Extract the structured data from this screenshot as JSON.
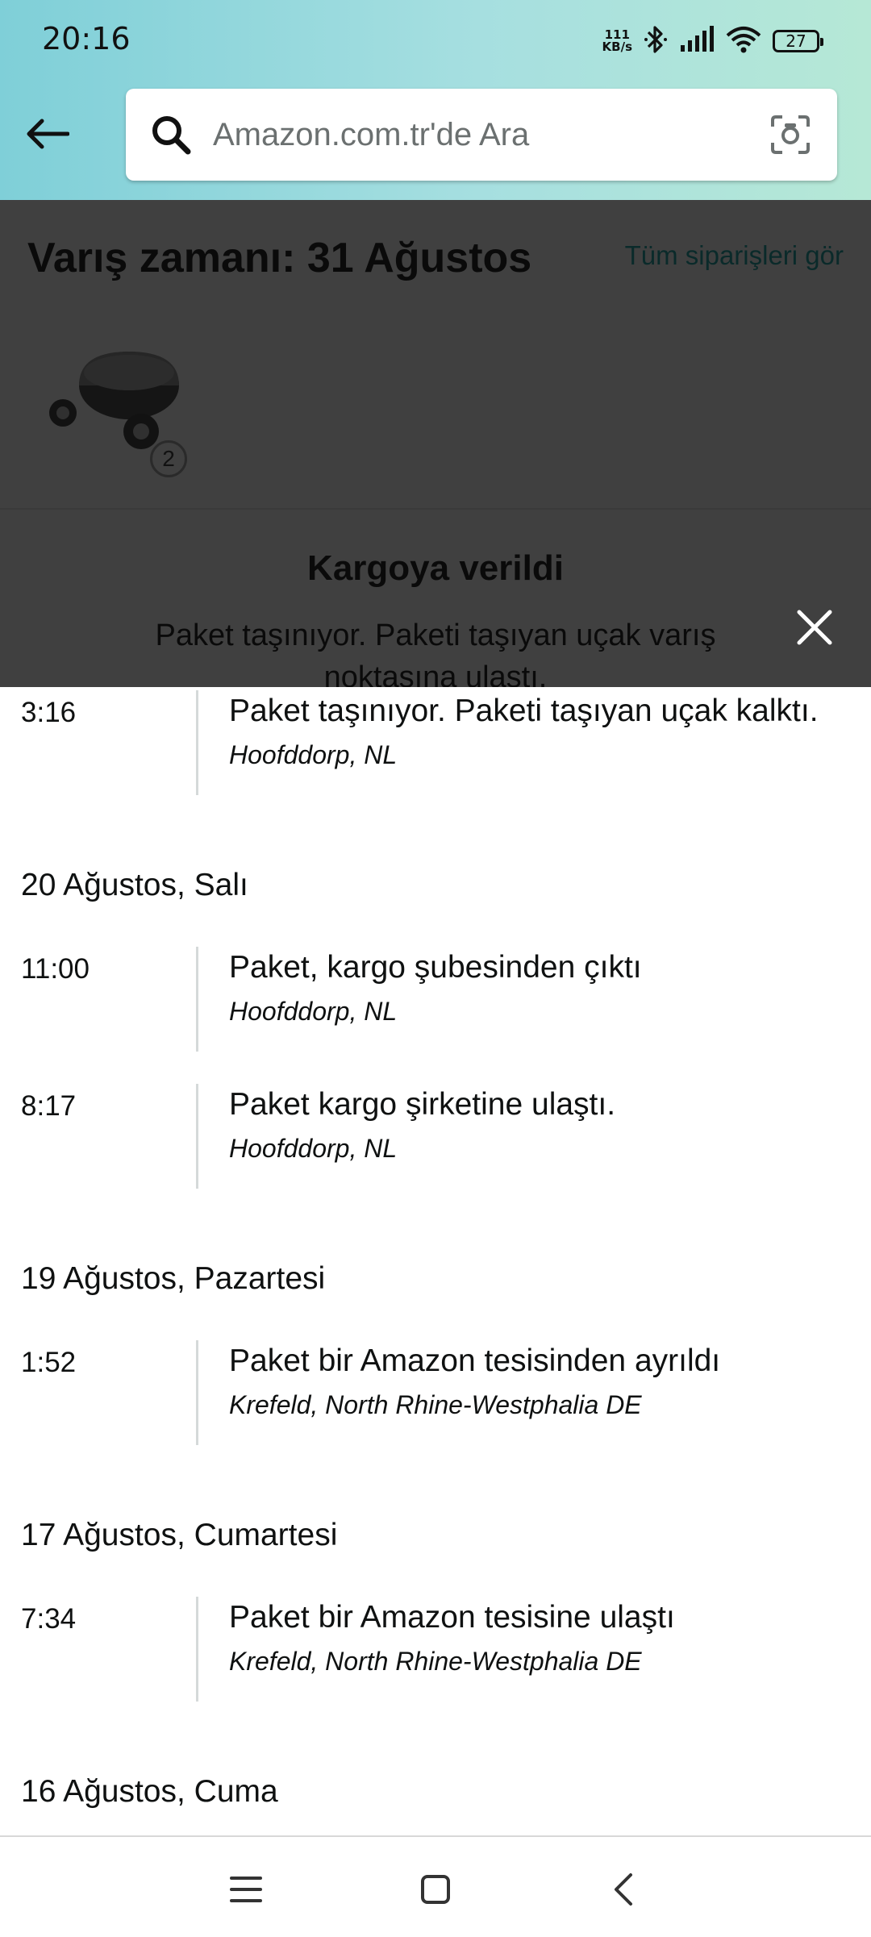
{
  "status_bar": {
    "time": "20:16",
    "net_speed_value": "111",
    "net_speed_unit": "KB/s",
    "battery_level": "27",
    "icons": [
      "bluetooth-icon",
      "signal-icon",
      "wifi-icon",
      "battery-icon"
    ]
  },
  "search": {
    "placeholder": "Amazon.com.tr'de Ara"
  },
  "order": {
    "arrival_title": "Varış zamanı: 31 Ağustos",
    "all_orders_link": "Tüm siparişleri gör",
    "quantity": "2",
    "status_title": "Kargoya verildi",
    "status_desc": "Paket taşınıyor. Paketi taşıyan uçak varış noktasına ulaştı."
  },
  "tracking": {
    "events": [
      {
        "time": "3:16",
        "desc": "Paket taşınıyor. Paketi taşıyan uçak kalktı.",
        "location": "Hoofddorp, NL"
      },
      {
        "time": "11:00",
        "desc": "Paket, kargo şubesinden çıktı",
        "location": "Hoofddorp, NL"
      },
      {
        "time": "8:17",
        "desc": "Paket kargo şirketine ulaştı.",
        "location": "Hoofddorp, NL"
      },
      {
        "time": "1:52",
        "desc": "Paket bir Amazon tesisinden ayrıldı",
        "location": "Krefeld, North Rhine-Westphalia DE"
      },
      {
        "time": "7:34",
        "desc": "Paket bir Amazon tesisine ulaştı",
        "location": "Krefeld, North Rhine-Westphalia DE"
      }
    ],
    "date_headers": [
      "20 Ağustos, Salı",
      "19 Ağustos, Pazartesi",
      "17 Ağustos, Cumartesi",
      "16 Ağustos, Cuma"
    ]
  },
  "colors": {
    "header_gradient_start": "#7fcfd8",
    "header_gradient_end": "#b6e8d6",
    "overlay": "#404040",
    "timeline_line": "#d5d9d9"
  }
}
